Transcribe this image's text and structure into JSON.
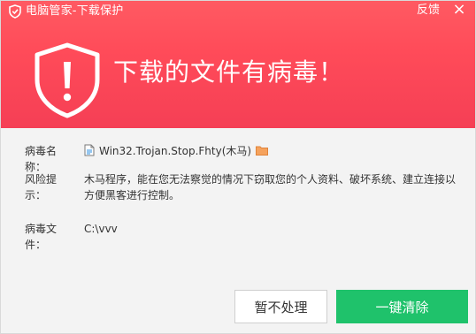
{
  "window": {
    "title": "电脑管家-下载保护",
    "feedback_label": "反馈",
    "close_glyph": "×"
  },
  "alert": {
    "title": "下载的文件有病毒！"
  },
  "details": {
    "virus_name_label": "病毒名称：",
    "virus_name_value": "Win32.Trojan.Stop.Fhty(木马)",
    "risk_label": "风险提示：",
    "risk_value": "木马程序，能在您无法察觉的情况下窃取您的个人资料、破坏系统、建立连接以方便黑客进行控制。",
    "file_label": "病毒文件：",
    "file_value": "C:\\vvv"
  },
  "buttons": {
    "ignore_label": "暂不处理",
    "clean_label": "一键清除"
  },
  "icons": {
    "app": "shield-icon",
    "alert": "warning-shield-icon",
    "file": "file-icon",
    "folder": "folder-icon"
  },
  "colors": {
    "header_red": "#f7485a",
    "clean_green": "#1fc26b"
  }
}
